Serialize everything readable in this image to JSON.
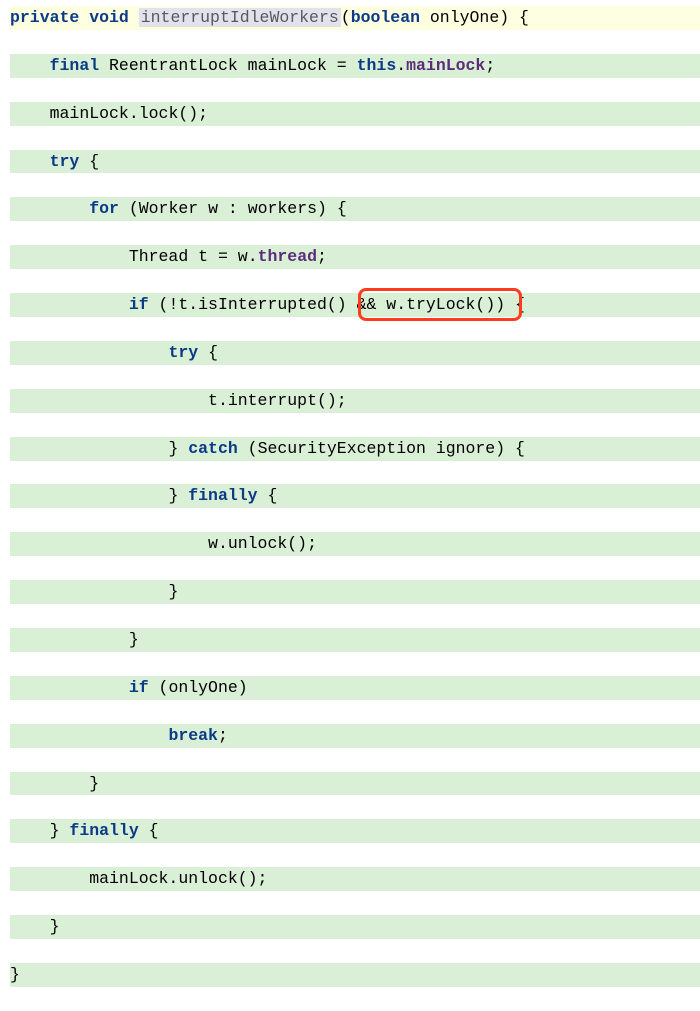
{
  "code": {
    "tokens": {
      "kw_private": "private",
      "kw_void": "void",
      "method_name": "interruptIdleWorkers",
      "lparen": "(",
      "kw_boolean": "boolean",
      "param_onlyOne": "onlyOne",
      "rparen": ")",
      "lbrace": "{",
      "rbrace": "}",
      "kw_final": "final",
      "type_ReentrantLock": "ReentrantLock",
      "id_mainLock": "mainLock",
      "eq": " = ",
      "kw_this": "this",
      "dot": ".",
      "field_mainLock": "mainLock",
      "semi": ";",
      "call_lock": "lock()",
      "kw_try": "try",
      "kw_for": "for",
      "type_Worker": "Worker",
      "id_w": "w",
      "colon": " : ",
      "id_workers": "workers",
      "type_Thread": "Thread",
      "id_t": "t",
      "field_thread": "thread",
      "kw_if": "if",
      "expr_notInt": "!t.isInterrupted()",
      "op_and": " && ",
      "expr_tryLock": "w.tryLock()",
      "call_interrupt": "t.interrupt();",
      "kw_catch": "catch",
      "catch_arg": "(SecurityException ignore)",
      "kw_finally": "finally",
      "call_wunlock": "w.unlock();",
      "kw_break": "break",
      "call_mainunlock": "mainLock.unlock();"
    }
  },
  "annotation": {
    "target": "w.tryLock() condition",
    "color": "#ff3b1f"
  },
  "chart_data": {
    "type": "table",
    "title": "Java code snippet: interruptIdleWorkers",
    "lines": [
      "private void interruptIdleWorkers(boolean onlyOne) {",
      "    final ReentrantLock mainLock = this.mainLock;",
      "    mainLock.lock();",
      "    try {",
      "        for (Worker w : workers) {",
      "            Thread t = w.thread;",
      "            if (!t.isInterrupted() && w.tryLock()) {",
      "                try {",
      "                    t.interrupt();",
      "                } catch (SecurityException ignore) {",
      "                } finally {",
      "                    w.unlock();",
      "                }",
      "            }",
      "            if (onlyOne)",
      "                break;",
      "        }",
      "    } finally {",
      "        mainLock.unlock();",
      "    }",
      "}"
    ],
    "highlight": {
      "line_index": 6,
      "substring": "&& w.tryLock()"
    }
  }
}
